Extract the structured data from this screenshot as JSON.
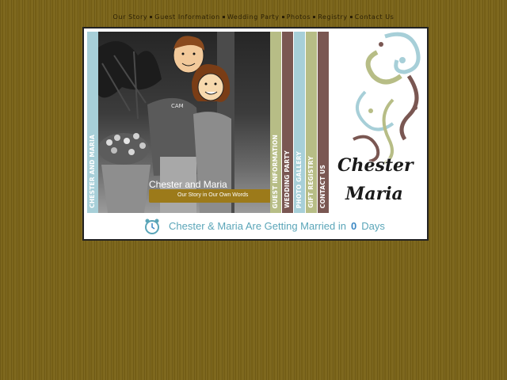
{
  "nav": {
    "items": [
      "Our Story",
      "Guest Information",
      "Wedding Party",
      "Photos",
      "Registry",
      "Contact Us"
    ]
  },
  "left_strip": {
    "label": "CHESTER AND MARIA"
  },
  "photo_caption": {
    "title": "Chester and Maria",
    "subtitle": "Our Story in Our Own Words"
  },
  "vertical_nav": [
    {
      "label": "GUEST INFORMATION",
      "color": "#b7bd86"
    },
    {
      "label": "WEDDING PARTY",
      "color": "#7a5752"
    },
    {
      "label": "PHOTO GALLERY",
      "color": "#a7cfd8"
    },
    {
      "label": "GIFT REGISTRY",
      "color": "#b7bd86"
    },
    {
      "label": "CONTACT US",
      "color": "#7a5752"
    }
  ],
  "logo": {
    "line1": "Chester",
    "line2": "Maria"
  },
  "countdown": {
    "prefix": "Chester & Maria Are Getting Married in",
    "days": "0",
    "suffix": "Days"
  },
  "colors": {
    "background": "#7a6317",
    "teal": "#a7cfd8",
    "olive": "#b7bd86",
    "brown": "#7a5752",
    "gold": "#9c7a1a"
  }
}
